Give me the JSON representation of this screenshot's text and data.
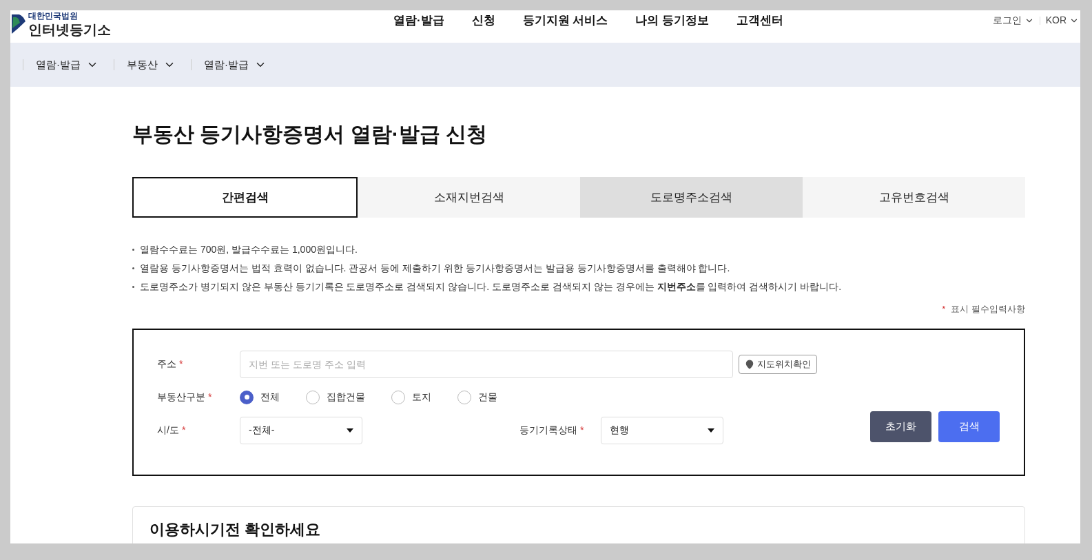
{
  "header": {
    "logo_top": "대한민국법원",
    "logo_main": "인터넷등기소",
    "nav": [
      "열람·발급",
      "신청",
      "등기지원 서비스",
      "나의 등기정보",
      "고객센터"
    ],
    "utility": [
      {
        "label": "로그인"
      },
      {
        "label": "KOR"
      }
    ]
  },
  "breadcrumb": [
    {
      "label": "열람·발급"
    },
    {
      "label": "부동산"
    },
    {
      "label": "열람·발급"
    }
  ],
  "page_title": "부동산 등기사항증명서 열람·발급 신청",
  "tabs": [
    {
      "label": "간편검색",
      "selected": true,
      "hovered": false
    },
    {
      "label": "소재지번검색",
      "selected": false,
      "hovered": false
    },
    {
      "label": "도로명주소검색",
      "selected": false,
      "hovered": true
    },
    {
      "label": "고유번호검색",
      "selected": false,
      "hovered": false
    }
  ],
  "notices": [
    "열람수수료는  700원, 발급수수료는  1,000원입니다.",
    "열람용 등기사항증명서는 법적 효력이 없습니다. 관공서 등에 제출하기 위한 등기사항증명서는 발급용 등기사항증명서를 출력해야 합니다.",
    "도로명주소가 병기되지 않은 부동산 등기기록은 도로명주소로 검색되지 않습니다. 도로명주소로 검색되지 않는 경우에는 **지번주소**를 입력하여 검색하시기 바랍니다."
  ],
  "required_mark": "*",
  "required_note": "표시 필수입력사항",
  "form": {
    "address": {
      "label": "주소",
      "placeholder": "지번 또는 도로명 주소 입력",
      "map_button": "지도위치확인"
    },
    "property_type": {
      "label": "부동산구분",
      "options": [
        {
          "label": "전체",
          "selected": true
        },
        {
          "label": "집합건물",
          "selected": false
        },
        {
          "label": "토지",
          "selected": false
        },
        {
          "label": "건물",
          "selected": false
        }
      ]
    },
    "region": {
      "label": "시/도",
      "value": "-전체-"
    },
    "status": {
      "label": "등기기록상태",
      "value": "현행"
    },
    "buttons": [
      {
        "label": "초기화",
        "kind": "secondary"
      },
      {
        "label": "검색",
        "kind": "primary"
      }
    ]
  },
  "info_card": {
    "title": "이용하시기전 확인하세요"
  }
}
